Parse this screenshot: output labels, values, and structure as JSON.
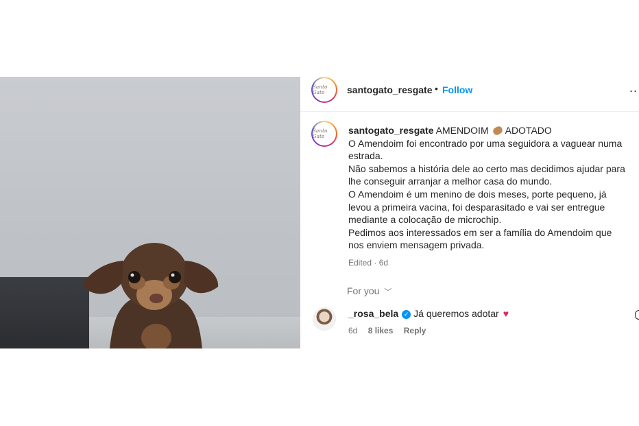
{
  "post": {
    "username": "santogato_resgate",
    "separator": "•",
    "follow_label": "Follow",
    "more_label": "..",
    "avatar_text": "Santo Gato"
  },
  "caption": {
    "username": "santogato_resgate",
    "title_part1": "AMENDOIM",
    "title_part2": "ADOTADO",
    "lines": [
      "O Amendoim foi encontrado por uma seguidora a vaguear numa",
      "estrada.",
      "Não sabemos a história dele ao certo mas decidimos ajudar para",
      "lhe conseguir arranjar a melhor casa do mundo.",
      "O Amendoim é um menino de dois meses, porte pequeno, já",
      "levou a primeira vacina, foi desparasitado e vai ser entregue",
      "mediante a colocação de microchip.",
      "Pedimos aos interessados em ser a família do Amendoim que",
      "nos enviem mensagem privada."
    ],
    "edited_label": "Edited · 6d"
  },
  "for_you_label": "For you",
  "chevron_glyph": "﹀",
  "next_glyph": "›",
  "comment": {
    "username": "_rosa_bela",
    "verified_glyph": "✓",
    "text": "Já queremos adotar",
    "heart": "♥",
    "time": "6d",
    "likes": "8 likes",
    "reply": "Reply"
  }
}
